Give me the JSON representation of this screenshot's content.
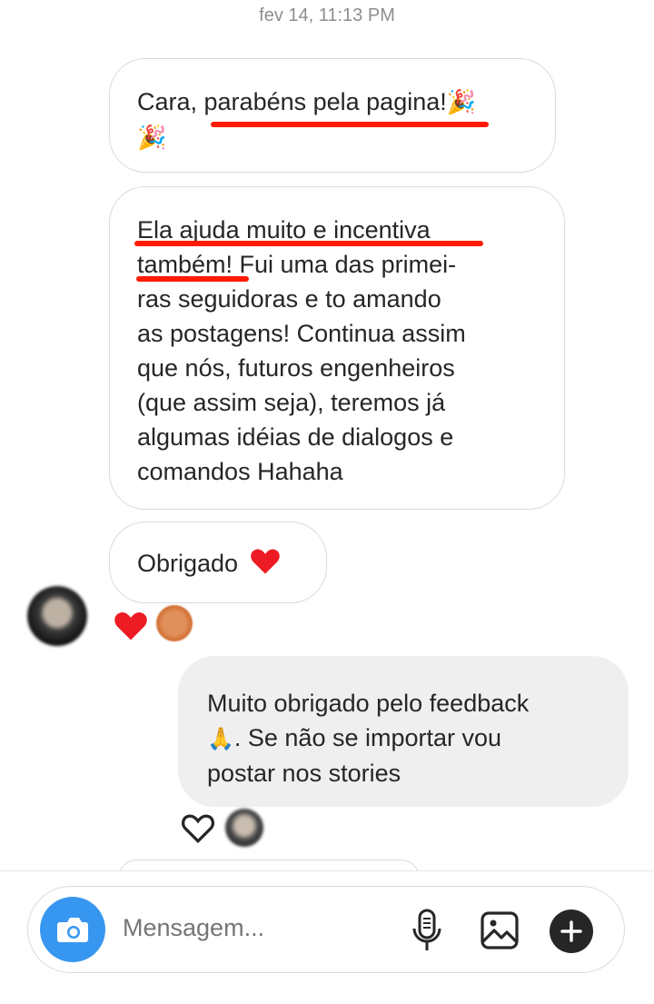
{
  "thread": {
    "timestamp": "fev 14, 11:13 PM",
    "messages": [
      {
        "sender": "them",
        "lines": [
          "Cara, parabéns pela pagina!"
        ]
      },
      {
        "sender": "them",
        "lines": [
          "Ela ajuda muito e incentiva",
          "também! Fui uma das primei-",
          "ras seguidoras e to amando",
          "as postagens! Continua assim",
          "que nós, futuros engenheiros",
          "(que assim seja), teremos já",
          "algumas idéias de dialogos e",
          "comandos Hahaha"
        ]
      },
      {
        "sender": "them",
        "text": "Obrigado",
        "emoji": "❤️"
      },
      {
        "sender": "me",
        "lines": [
          "Muito obrigado pelo feedback",
          ". Se não se importar vou",
          "postar nos stories"
        ],
        "emoji": "🙏"
      }
    ],
    "party_emoji": "🎉"
  },
  "composer": {
    "placeholder": "Mensagem...",
    "camera_icon": "camera-icon",
    "mic_icon": "microphone-icon",
    "gallery_icon": "image-icon",
    "plus_icon": "plus-icon"
  },
  "colors": {
    "accent": "#3797f0",
    "highlight": "#ff1a00",
    "heart": "#ed1c24"
  }
}
